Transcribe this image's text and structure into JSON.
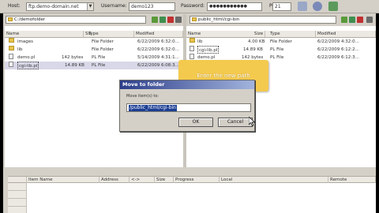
{
  "toolbar": {
    "host_label": "Host:",
    "host_value": "ftp.demo-domain.net",
    "username_label": "Username:",
    "username_value": "demo123",
    "password_label": "Password:",
    "password_value": "●●●●●●●●●●●",
    "port_label": "Port:",
    "port_value": "21"
  },
  "left_pane": {
    "path": "C:/demofolder",
    "columns": [
      "Name",
      "Size",
      "Type",
      "Modified"
    ],
    "rows": [
      {
        "name": "images",
        "size": "",
        "type": "File Folder",
        "modified": "6/22/2009 6:32:0..."
      },
      {
        "name": "lib",
        "size": "",
        "type": "File Folder",
        "modified": "6/22/2009 6:32:0..."
      },
      {
        "name": "demo.pl",
        "size": "142 bytes",
        "type": "PL File",
        "modified": "5/14/2009 4:31:1..."
      },
      {
        "name": "cgi-lib.pl",
        "size": "14.89 KB",
        "type": "PL File",
        "modified": "6/22/2009 6:08:3..."
      }
    ]
  },
  "right_pane": {
    "path": "public_html/cgi-bin",
    "columns": [
      "Name",
      "Size",
      "Type",
      "Modified"
    ],
    "rows": [
      {
        "name": "lib",
        "size": "4.00 KB",
        "type": "File Folder",
        "modified": "6/22/2009 4:32:0..."
      },
      {
        "name": "cgi-lib.pl",
        "size": "14.89 KB",
        "type": "PL File",
        "modified": "6/22/2009 6:12:2..."
      },
      {
        "name": "demo.pl",
        "size": "142 bytes",
        "type": "PL File",
        "modified": "6/22/2009 6:12:3..."
      }
    ]
  },
  "dialog": {
    "title": "Move to folder",
    "prompt": "Move item(s) to:",
    "input_value": "/public_html/cgi-bin",
    "ok_label": "OK",
    "cancel_label": "Cancel"
  },
  "tooltip": {
    "text": "Enter the new path"
  },
  "queue": {
    "columns": [
      "Item Name",
      "Address",
      "<->",
      "Size",
      "Progress",
      "Local",
      "Remote"
    ]
  },
  "colors": {
    "toolbar_bg": "#d4d0c8",
    "dialog_title_start": "#2c3d8a",
    "dialog_title_end": "#a2b4dd",
    "tooltip_bg": "#f4ca4e",
    "folder": "#e8c44a"
  },
  "icons": {
    "toolbar": [
      "connect-icon",
      "disconnect-icon",
      "refresh-icon"
    ],
    "pane_tools": [
      "folder-up-icon",
      "refresh-icon",
      "delete-icon",
      "properties-icon"
    ]
  }
}
